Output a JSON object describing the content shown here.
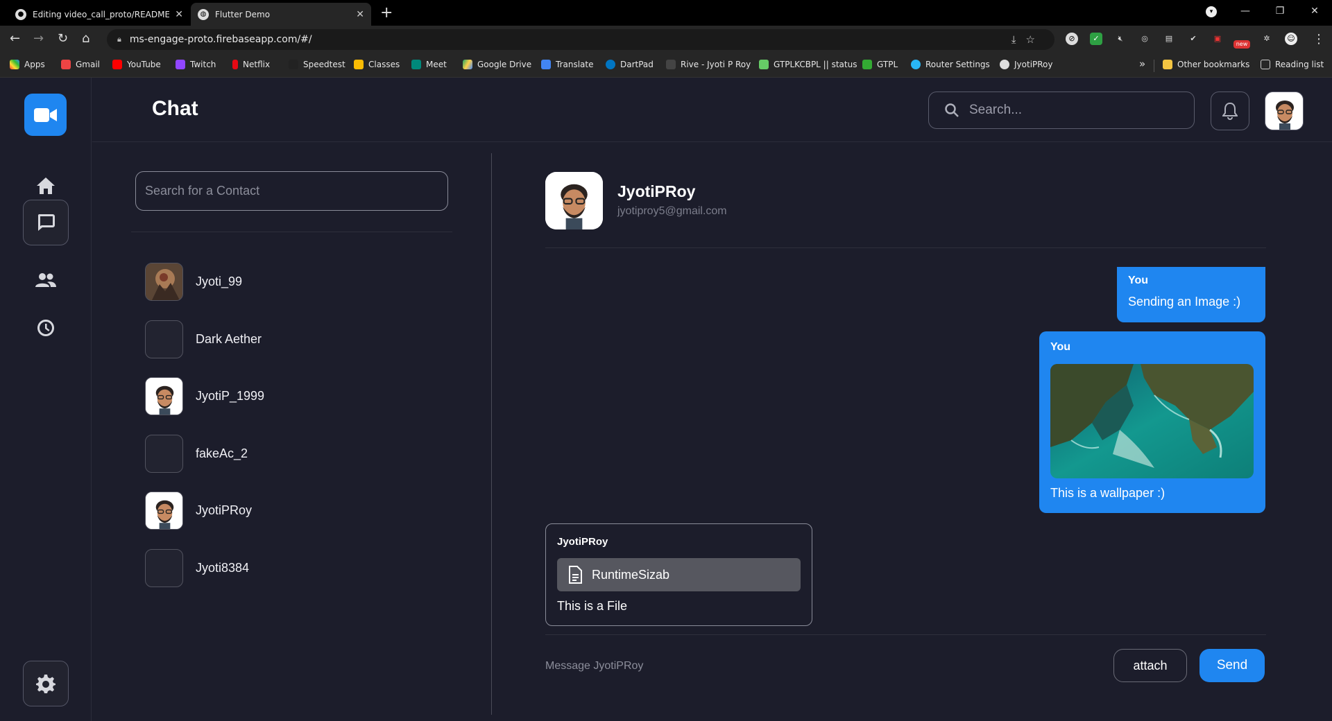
{
  "browser": {
    "tabs": [
      {
        "title": "Editing video_call_proto/README.m",
        "icon": "github-icon"
      },
      {
        "title": "Flutter Demo",
        "icon": "globe-icon"
      }
    ],
    "url": "ms-engage-proto.firebaseapp.com/#/",
    "bookmarks": [
      "Apps",
      "Gmail",
      "YouTube",
      "Twitch",
      "Netflix",
      "Speedtest",
      "Classes",
      "Meet",
      "Google Drive",
      "Translate",
      "DartPad",
      "Rive - Jyoti P Roy",
      "GTPLKCBPL || status",
      "GTPL",
      "Router Settings",
      "JyotiPRoy"
    ],
    "other_bookmarks": "Other bookmarks",
    "reading_list": "Reading list",
    "badge_new": "new"
  },
  "app": {
    "title": "Chat",
    "search_placeholder": "Search...",
    "accent": "#1f86f0",
    "background": "#1c1d2b"
  },
  "contacts": {
    "search_placeholder": "Search for a Contact",
    "items": [
      {
        "name": "Jyoti_99",
        "avatar": "painting"
      },
      {
        "name": "Dark Aether",
        "avatar": "empty"
      },
      {
        "name": "JyotiP_1999",
        "avatar": "bitmoji"
      },
      {
        "name": "fakeAc_2",
        "avatar": "empty"
      },
      {
        "name": "JyotiPRoy",
        "avatar": "bitmoji"
      },
      {
        "name": "Jyoti8384",
        "avatar": "empty"
      }
    ]
  },
  "chat": {
    "name": "JyotiPRoy",
    "email": "jyotiproy5@gmail.com",
    "messages": [
      {
        "from": "You",
        "text": "Sending an Image :)"
      },
      {
        "from": "You",
        "text": "This is a wallpaper :)",
        "image": "aerial-coastline"
      },
      {
        "from": "JyotiPRoy",
        "file": "RuntimeSizab",
        "text": "This is a File"
      }
    ],
    "input_placeholder": "Message JyotiPRoy",
    "attach_label": "attach",
    "send_label": "Send"
  }
}
